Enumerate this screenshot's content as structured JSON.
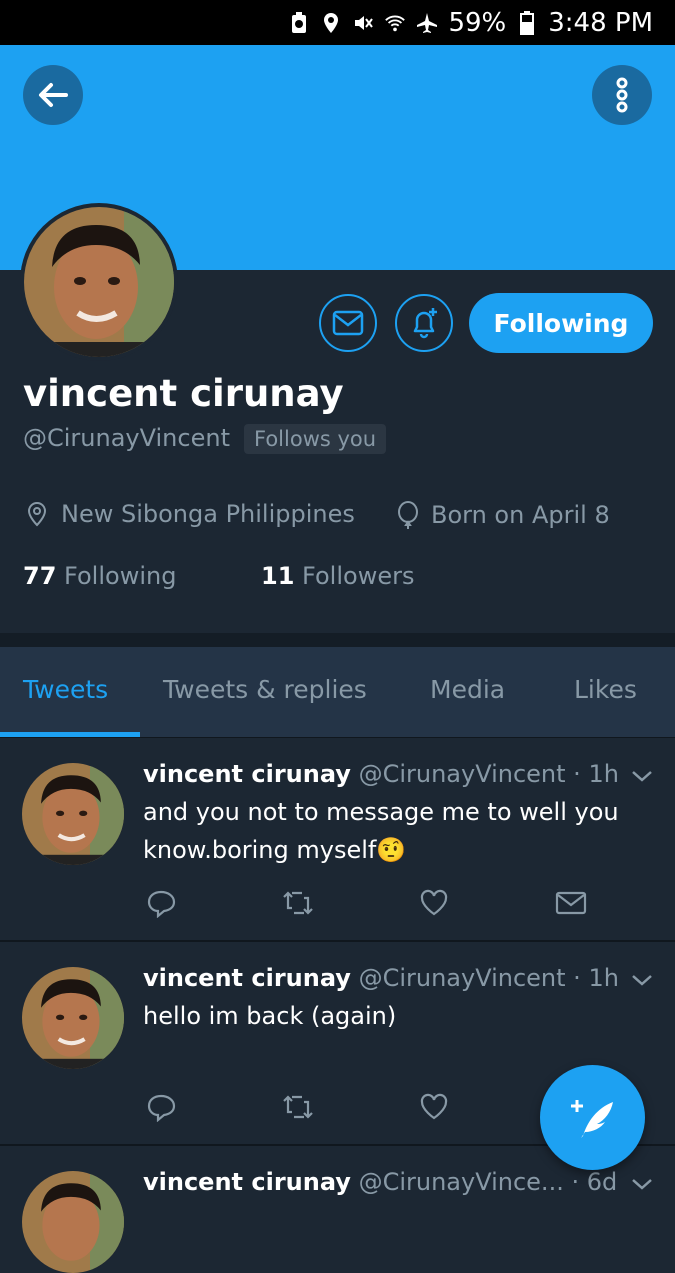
{
  "status_bar": {
    "battery_percent": "59%",
    "time": "3:48 PM",
    "icons": [
      "battery-saver-icon",
      "location-icon",
      "mute-icon",
      "wifi-icon",
      "airplane-icon",
      "battery-icon"
    ]
  },
  "header": {
    "back_icon": "arrow-left-icon",
    "more_icon": "more-vertical-icon",
    "banner_color": "#1da1f2"
  },
  "profile": {
    "name": "vincent cirunay",
    "handle": "@CirunayVincent",
    "follows_you": "Follows you",
    "following_button": "Following",
    "location": "New Sibonga Philippines",
    "birthday": "Born on April 8",
    "following_count": "77",
    "following_label": "Following",
    "followers_count": "11",
    "followers_label": "Followers"
  },
  "tabs": [
    {
      "label": "Tweets",
      "active": true
    },
    {
      "label": "Tweets & replies",
      "active": false
    },
    {
      "label": "Media",
      "active": false
    },
    {
      "label": "Likes",
      "active": false
    }
  ],
  "tweets": [
    {
      "name": "vincent cirunay",
      "meta": "@CirunayVincent · 1h",
      "text": "and you not to message me to well you know.boring myself🤨"
    },
    {
      "name": "vincent cirunay",
      "meta": "@CirunayVincent · 1h",
      "text": "hello im back (again)"
    },
    {
      "name": "vincent cirunay",
      "meta": "@CirunayVince... · 6d",
      "text": ""
    }
  ],
  "colors": {
    "accent": "#1da1f2",
    "background": "#1c2733",
    "tabs_background": "#243447",
    "secondary_text": "#8899a6"
  }
}
